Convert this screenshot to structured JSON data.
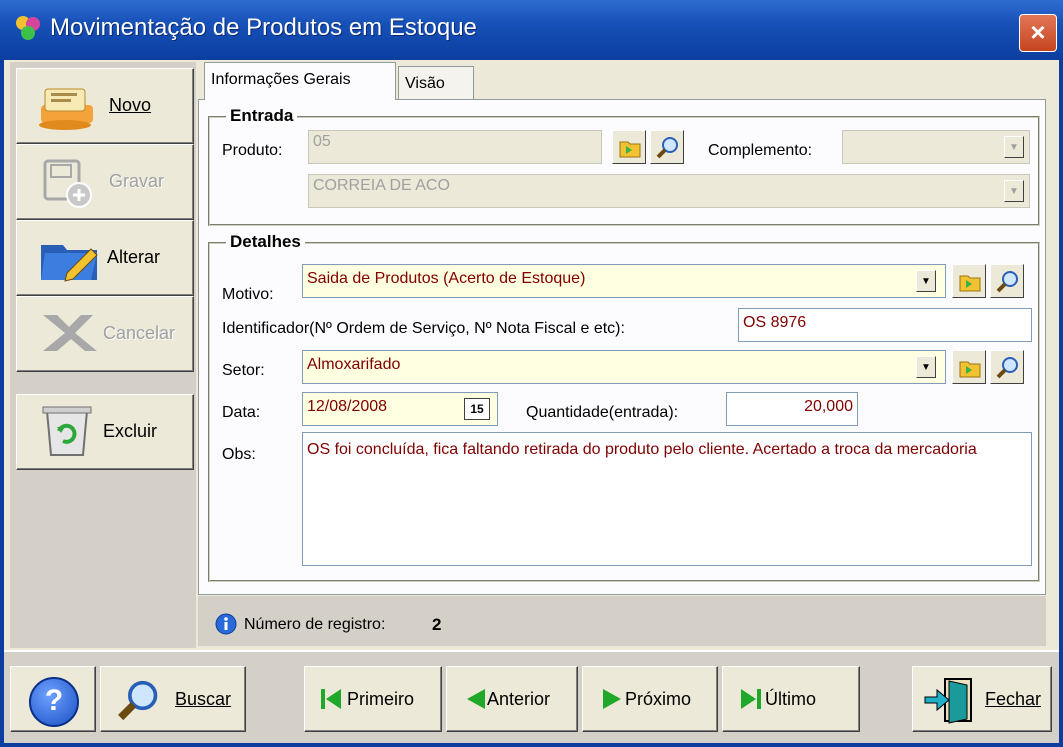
{
  "window": {
    "title": "Movimentação de Produtos em Estoque",
    "close_label": "×"
  },
  "sidebar": {
    "novo": "Novo",
    "gravar": "Gravar",
    "alterar": "Alterar",
    "cancelar": "Cancelar",
    "excluir": "Excluir"
  },
  "tabs": {
    "geral": "Informações Gerais",
    "visao": "Visão"
  },
  "entrada": {
    "title": "Entrada",
    "produto_label": "Produto:",
    "produto_code": "05",
    "complemento_label": "Complemento:",
    "complemento_value": "",
    "produto_desc": "CORREIA DE ACO"
  },
  "detalhes": {
    "title": "Detalhes",
    "motivo_label": "Motivo:",
    "motivo_value": "Saida de Produtos (Acerto de Estoque)",
    "identificador_label": "Identificador(Nº Ordem de Serviço, Nº Nota Fiscal e etc):",
    "identificador_value": "OS 8976",
    "setor_label": "Setor:",
    "setor_value": "Almoxarifado",
    "data_label": "Data:",
    "data_value": "12/08/2008",
    "calendar_day": "15",
    "quantidade_label": "Quantidade(entrada):",
    "quantidade_value": "20,000",
    "obs_label": "Obs:",
    "obs_value": "OS foi concluída, fica faltando retirada do produto pelo cliente. Acertado a troca da mercadoria"
  },
  "status": {
    "label": "Número de registro:",
    "value": "2"
  },
  "bottom": {
    "help": "?",
    "buscar": "Buscar",
    "primeiro": "Primeiro",
    "anterior": "Anterior",
    "proximo": "Próximo",
    "ultimo": "Último",
    "fechar": "Fechar"
  },
  "colors": {
    "titlebar": "#1650b8",
    "frame": "#ece9d8",
    "input_text": "#800000",
    "required_bg": "#ffffe1"
  },
  "icons": [
    "app-icon",
    "close-icon",
    "novo-icon",
    "gravar-icon",
    "alterar-icon",
    "cancelar-icon",
    "excluir-icon",
    "folder-icon",
    "search-icon",
    "calendar-icon",
    "info-icon",
    "help-icon",
    "first-icon",
    "previous-icon",
    "next-icon",
    "last-icon",
    "exit-door-icon",
    "dropdown-arrow-icon"
  ]
}
